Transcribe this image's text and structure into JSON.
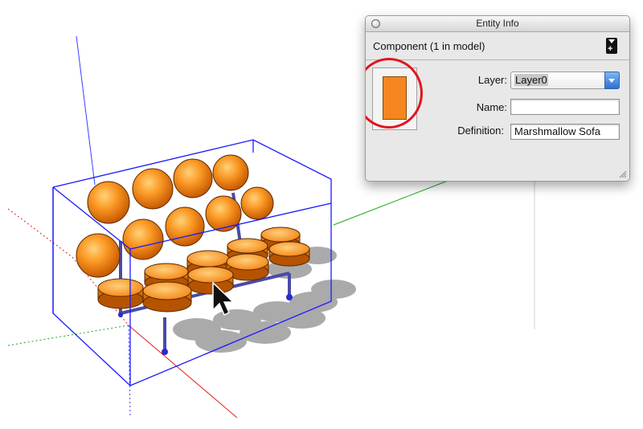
{
  "window": {
    "title": "Entity Info"
  },
  "entity_info": {
    "component_label": "Component (1 in model)",
    "layer_label": "Layer:",
    "layer_value": "Layer0",
    "name_label": "Name:",
    "name_value": "",
    "definition_label": "Definition:",
    "definition_value": "Marshmallow Sofa",
    "swatch_color": "#f5861f"
  },
  "icons": {
    "close": "close-icon",
    "collapse": "collapse-icon",
    "dropdown": "chevron-down-icon",
    "resize": "resize-grip-icon",
    "cursor": "select-cursor-icon"
  },
  "colors": {
    "axis_blue": "#3b3bff",
    "axis_red": "#e02020",
    "axis_green": "#1aa61a",
    "cushion_orange": "#f5861f",
    "bounding_box": "#1a1aff",
    "highlight": "#e0161e"
  }
}
